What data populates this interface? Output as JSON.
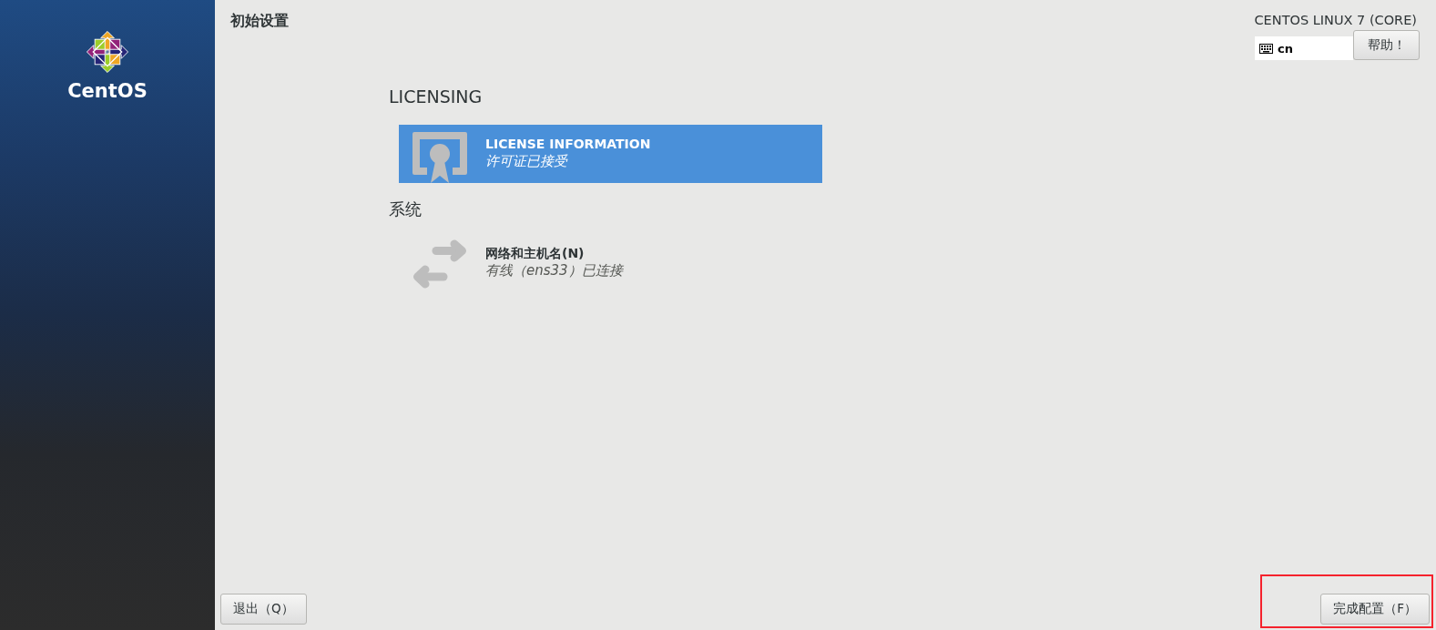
{
  "window": {
    "title": "初始设置",
    "product": "CENTOS LINUX 7 (CORE)"
  },
  "sidebar": {
    "logo_text": "CentOS"
  },
  "keyboard_layout": {
    "label": "cn"
  },
  "help_button": {
    "label": "帮助！"
  },
  "sections": [
    {
      "title": "LICENSING",
      "items": [
        {
          "kind": "license",
          "title": "LICENSE INFORMATION",
          "status": "许可证已接受",
          "selected": true
        }
      ]
    },
    {
      "title": "系统",
      "items": [
        {
          "kind": "network",
          "title": "网络和主机名(N)",
          "status": "有线（ens33）已连接",
          "selected": false
        }
      ]
    }
  ],
  "buttons": [
    {
      "label": "退出（Q）",
      "highlighted": false
    },
    {
      "label": "完成配置（F）",
      "highlighted": true
    }
  ]
}
